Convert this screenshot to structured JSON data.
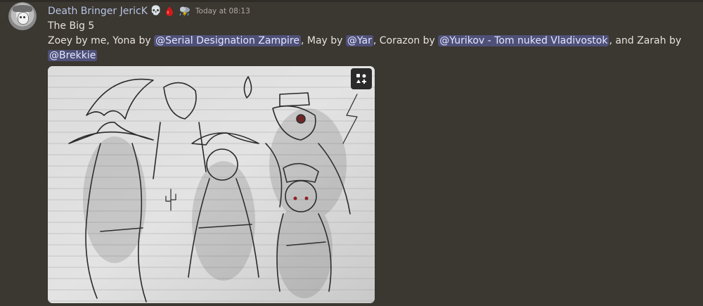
{
  "message": {
    "author": "Death Bringer JericK",
    "timestamp": "Today at 08:13",
    "badges": [
      "skull-icon",
      "blood-drop-icon",
      "storm-cloud-icon"
    ],
    "title_line": "The Big 5",
    "body_segments_line2": [
      "Zoey by me, Yona by ",
      "@Serial Designation Zampire",
      ", May by ",
      "@Yar",
      ", Corazon by ",
      "@Yurikov - Tom nuked Vladivostok",
      ", and Zarah by"
    ],
    "body_line3_mention": "@Brekkie"
  },
  "attachment": {
    "type": "image",
    "description_icon": "media-actions-icon"
  },
  "colors": {
    "background": "#3b3731",
    "username": "#b7c4e4",
    "text": "#e7e3dc",
    "mention_bg": "#4f5078",
    "mention_text": "#e3e6ff"
  }
}
